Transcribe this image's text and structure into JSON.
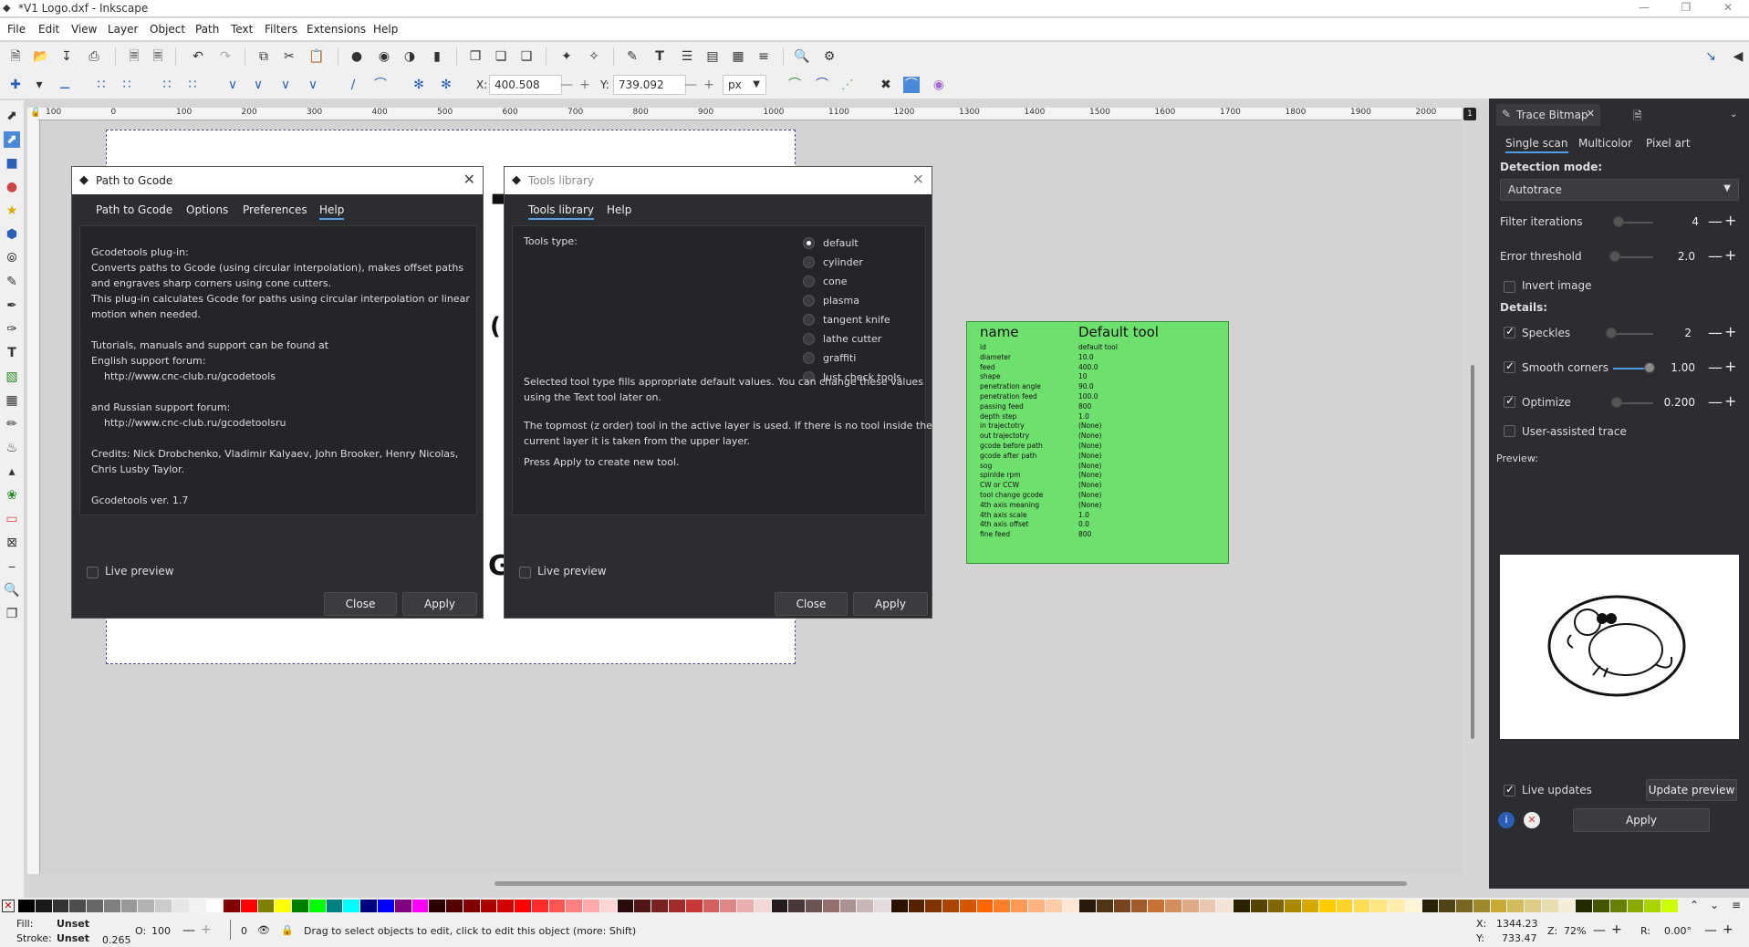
{
  "window": {
    "title": "*V1 Logo.dxf - Inkscape"
  },
  "menu": [
    "File",
    "Edit",
    "View",
    "Layer",
    "Object",
    "Path",
    "Text",
    "Filters",
    "Extensions",
    "Help"
  ],
  "coords": {
    "x_label": "X:",
    "x_value": "400.508",
    "y_label": "Y:",
    "y_value": "739.092",
    "unit": "px"
  },
  "hruler_ticks": [
    "100",
    "0",
    "100",
    "200",
    "300",
    "400",
    "500",
    "600",
    "700",
    "800",
    "900",
    "1000",
    "1100",
    "1200",
    "1300",
    "1400",
    "1500",
    "1600",
    "1700",
    "1800",
    "1900",
    "2000"
  ],
  "canvas_badge": "1",
  "path_to_gcode": {
    "title": "Path to Gcode",
    "tabs": [
      "Path to Gcode",
      "Options",
      "Preferences",
      "Help"
    ],
    "active_tab": "Help",
    "help_lines": [
      "Gcodetools plug-in:",
      "Converts paths to Gcode (using circular interpolation), makes offset paths",
      "and engraves sharp corners using cone cutters.",
      "This plug-in calculates Gcode for paths using circular interpolation or linear",
      "motion when needed.",
      "",
      "Tutorials, manuals and support can be found at",
      "English support forum:",
      "    http://www.cnc-club.ru/gcodetools",
      "",
      "and Russian support forum:",
      "    http://www.cnc-club.ru/gcodetoolsru",
      "",
      "Credits: Nick Drobchenko, Vladimir Kalyaev, John Brooker, Henry Nicolas,",
      "Chris Lusby Taylor.",
      "",
      "Gcodetools ver. 1.7"
    ],
    "live_preview": "Live preview",
    "close": "Close",
    "apply": "Apply"
  },
  "tools_library": {
    "title": "Tools library",
    "tabs": [
      "Tools library",
      "Help"
    ],
    "tools_type_label": "Tools type:",
    "options": [
      "default",
      "cylinder",
      "cone",
      "plasma",
      "tangent knife",
      "lathe cutter",
      "graffiti",
      "Just check tools"
    ],
    "selected": "default",
    "desc1": "Selected tool type fills appropriate default values. You can change these values\nusing the Text tool later on.",
    "desc2": "The topmost (z order) tool in the active layer is used. If there is no tool inside the\ncurrent layer it is taken from the upper layer.",
    "desc3": "Press Apply to create new tool.",
    "live_preview": "Live preview",
    "close": "Close",
    "apply": "Apply"
  },
  "tool_card": {
    "name_header": "name",
    "value_header": "Default tool",
    "rows": [
      [
        "id",
        "default tool"
      ],
      [
        "diameter",
        "10.0"
      ],
      [
        "feed",
        "400.0"
      ],
      [
        "shape",
        "10"
      ],
      [
        "penetration angle",
        "90.0"
      ],
      [
        "penetration feed",
        "100.0"
      ],
      [
        "passing feed",
        "800"
      ],
      [
        "depth step",
        "1.0"
      ],
      [
        "in trajectotry",
        "(None)"
      ],
      [
        "out trajectotry",
        "(None)"
      ],
      [
        "gcode before path",
        "(None)"
      ],
      [
        "gcode after path",
        "(None)"
      ],
      [
        "sog",
        "(None)"
      ],
      [
        "spinlde rpm",
        "(None)"
      ],
      [
        "CW or CCW",
        "(None)"
      ],
      [
        "tool change gcode",
        "(None)"
      ],
      [
        "4th axis meaning",
        "(None)"
      ],
      [
        "4th axis scale",
        "1.0"
      ],
      [
        "4th axis offset",
        "0.0"
      ],
      [
        "fine feed",
        "800"
      ]
    ]
  },
  "trace_bitmap": {
    "title": "Trace Bitmap",
    "tabs": [
      "Single scan",
      "Multicolor",
      "Pixel art"
    ],
    "detection_mode_label": "Detection mode:",
    "detection_mode": "Autotrace",
    "filter_iterations_label": "Filter iterations",
    "filter_iterations": "4",
    "error_threshold_label": "Error threshold",
    "error_threshold": "2.0",
    "invert_image": "Invert image",
    "details_label": "Details:",
    "speckles_label": "Speckles",
    "speckles": "2",
    "smooth_corners_label": "Smooth corners",
    "smooth_corners": "1.00",
    "optimize_label": "Optimize",
    "optimize": "0.200",
    "user_assisted": "User-assisted trace",
    "preview_label": "Preview:",
    "live_updates": "Live updates",
    "update_preview": "Update preview",
    "apply": "Apply"
  },
  "status": {
    "fill_label": "Fill:",
    "fill_value": "Unset",
    "stroke_label": "Stroke:",
    "stroke_value": "Unset",
    "stroke_width": "0.265",
    "opacity_label": "O:",
    "opacity_value": "100",
    "layer_value": "0",
    "message": "Drag to select objects to edit, click to edit this object (more: Shift)",
    "x_label": "X:",
    "x_value": "1344.23",
    "y_label": "Y:",
    "y_value": "733.47",
    "zoom_label": "Z:",
    "zoom_value": "72%",
    "rot_label": "R:",
    "rot_value": "0.00°"
  },
  "palette_colors": [
    "#000000",
    "#1a1a1a",
    "#333333",
    "#4d4d4d",
    "#666666",
    "#808080",
    "#999999",
    "#b3b3b3",
    "#cccccc",
    "#e6e6e6",
    "#f2f2f2",
    "#ffffff",
    "#800000",
    "#ff0000",
    "#808000",
    "#ffff00",
    "#008000",
    "#00ff00",
    "#008080",
    "#00ffff",
    "#000080",
    "#0000ff",
    "#800080",
    "#ff00ff",
    "#2b0000",
    "#550000",
    "#800000",
    "#aa0000",
    "#d40000",
    "#ff0000",
    "#ff2a2a",
    "#ff5555",
    "#ff8080",
    "#ffaaaa",
    "#ffd5d5",
    "#280b0b",
    "#501616",
    "#782121",
    "#a02c2c",
    "#c83737",
    "#d35f5f",
    "#de8787",
    "#e9afaf",
    "#f4d7d7",
    "#241c1c",
    "#483737",
    "#6c5353",
    "#916f6f",
    "#ac9393",
    "#c8b7b7",
    "#e3dbdb",
    "#2b1100",
    "#552200",
    "#803300",
    "#aa4400",
    "#d45500",
    "#ff6600",
    "#ff7f2a",
    "#ff9955",
    "#ffb380",
    "#ffccaa",
    "#ffe6d5",
    "#281a0b",
    "#503416",
    "#784421",
    "#a05a2c",
    "#c87137",
    "#d38d5f",
    "#deaa87",
    "#e9c6af",
    "#f4e3d7",
    "#2b2200",
    "#554400",
    "#806600",
    "#aa8800",
    "#d4aa00",
    "#ffcc00",
    "#ffd42a",
    "#ffdd55",
    "#ffe680",
    "#ffeeaa",
    "#fff6d5",
    "#28220b",
    "#504416",
    "#786721",
    "#a0892c",
    "#c8ab37",
    "#d3bc5f",
    "#decd87",
    "#e9ddaf",
    "#f4eed7",
    "#222b00",
    "#445500",
    "#668000",
    "#88aa00",
    "#aad400",
    "#ccff00"
  ]
}
